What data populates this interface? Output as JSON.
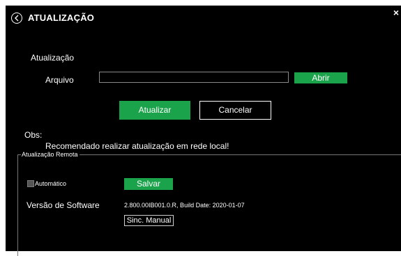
{
  "header": {
    "title": "ATUALIZAÇÃO",
    "close_glyph": "×",
    "back_icon": "chevron-left-circle-icon"
  },
  "update": {
    "section_label": "Atualização",
    "file_label": "Arquivo",
    "file_value": "",
    "open_label": "Abrir",
    "update_label": "Atualizar",
    "cancel_label": "Cancelar"
  },
  "notes": {
    "obs_label": "Obs:",
    "obs_text": "Recomendado realizar atualização em rede local!"
  },
  "remote": {
    "legend": "Atualização Remota",
    "auto_label": "Automático",
    "auto_checked": false,
    "save_label": "Salvar",
    "version_label": "Versão de Software",
    "version_value": "2.800.00IB001.0.R, Build Date: 2020-01-07",
    "sync_label": "Sinc. Manual"
  },
  "colors": {
    "background": "#000000",
    "accent_green": "#1aa34a",
    "text": "#ffffff"
  }
}
